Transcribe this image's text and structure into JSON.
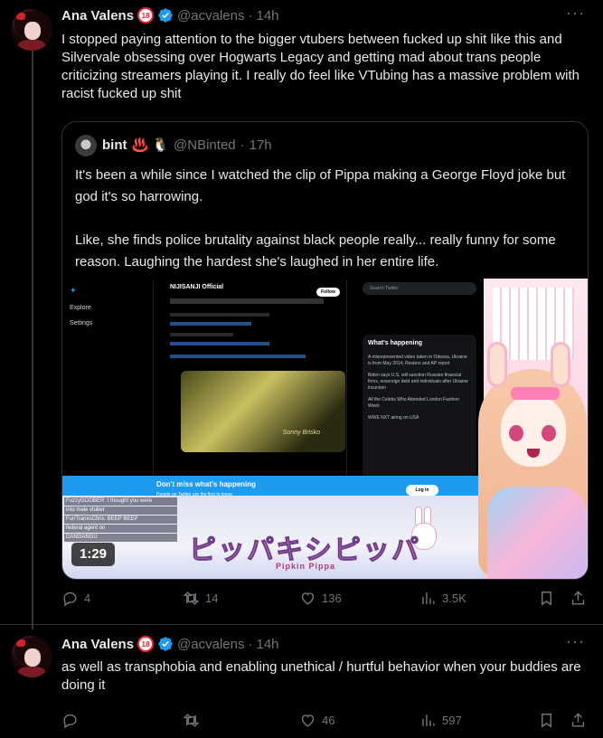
{
  "tweets": [
    {
      "author": {
        "name": "Ana Valens",
        "handle": "@acvalens",
        "badge": "18",
        "time": "14h"
      },
      "more": "···",
      "text": "I stopped paying attention to the bigger vtubers between fucked up shit like this and Silvervale obsessing over Hogwarts Legacy and getting mad about trans people criticizing streamers playing it. I really do feel like VTubing has a massive problem with racist fucked up shit",
      "quote": {
        "author": {
          "name": "bint",
          "emoji": "♨️ 🐧",
          "handle": "@NBinted",
          "time": "17h"
        },
        "paragraphs": [
          "It's been a while since I watched the clip of Pippa making a George Floyd joke but god it's so harrowing.",
          "",
          "Like, she finds police brutality against black people really... really funny for some reason. Laughing the hardest she's laughed in her entire life."
        ],
        "video": {
          "duration": "1:29",
          "embedded": {
            "nav": [
              "Explore",
              "Settings"
            ],
            "account": "NIJISANJI Official",
            "follow": "Follow",
            "search": "Search Twitter",
            "trending_header": "What's happening",
            "trends": [
              "A misrepresented video taken in Odessa, Ukraine is from May 2014, Reuters and AP report",
              "Biden says U.S. will sanction Russian financial firms, sovereign debt and individuals after Ukraine incursion",
              "All the Celebs Who Attended London Fashion Week",
              "WWE NXT airing on USA"
            ],
            "card_caption": "Sonny Brisko",
            "banner_title": "Don't miss what's happening",
            "banner_sub": "People on Twitter are the first to know.",
            "login": "Log in",
            "chat": [
              "FuzzyGOOBER: I thought you were",
              "into male vtuber",
              "FunTranxsChris: BEEP BEEP",
              "federal agent on",
              "DANGANGU"
            ],
            "stream_logo": "ピッパキシピッパ",
            "stream_sub": "Pipkin Pippa"
          }
        }
      },
      "actions": {
        "replies": "4",
        "retweets": "14",
        "likes": "136",
        "views": "3.5K"
      }
    },
    {
      "author": {
        "name": "Ana Valens",
        "handle": "@acvalens",
        "badge": "18",
        "time": "14h"
      },
      "more": "···",
      "text": "as well as transphobia and enabling unethical / hurtful behavior when your buddies are doing it",
      "actions": {
        "replies": "",
        "retweets": "",
        "likes": "46",
        "views": "597"
      }
    }
  ],
  "colors": {
    "background": "#000000",
    "text": "#e7e9ea",
    "muted": "#71767b",
    "verified": "#1d9bf0",
    "border": "#2f3336"
  }
}
